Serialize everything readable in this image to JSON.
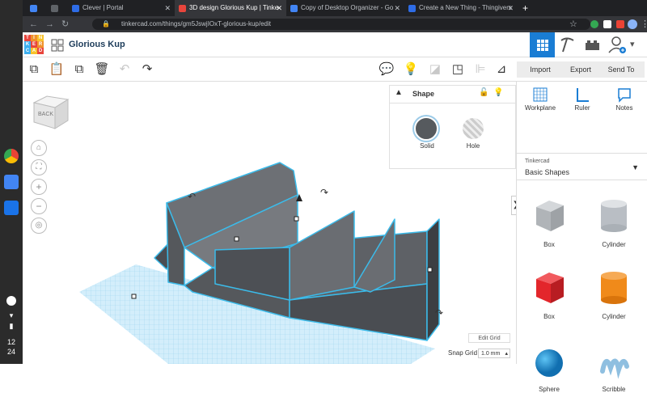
{
  "browser": {
    "tabs": [
      {
        "label": "",
        "color": "#4285f4"
      },
      {
        "label": "",
        "color": "#5f6368"
      },
      {
        "label": "Clever | Portal",
        "color": "#2e6ce6"
      },
      {
        "label": "3D design Glorious Kup | Tinke",
        "color": "#e8453c",
        "active": true
      },
      {
        "label": "Copy of Desktop Organizer - Go",
        "color": "#4285f4"
      },
      {
        "label": "Create a New Thing - Thingivers",
        "color": "#2e6ce6"
      }
    ],
    "url": "tinkercad.com/things/gm5JswjIOxT-glorious-kup/edit"
  },
  "shelf": {
    "time_hour": "12",
    "time_min": "24"
  },
  "app": {
    "logo": [
      "T",
      "I",
      "N",
      "K",
      "E",
      "R",
      "C",
      "A",
      "D"
    ],
    "design_title": "Glorious Kup",
    "actions": {
      "import": "Import",
      "export": "Export",
      "send_to": "Send To"
    }
  },
  "viewcube": {
    "label": "BACK"
  },
  "shape_panel": {
    "title": "Shape",
    "solid": "Solid",
    "hole": "Hole"
  },
  "right_panel": {
    "tools": {
      "workplane": "Workplane",
      "ruler": "Ruler",
      "notes": "Notes"
    },
    "library_label": "Tinkercad",
    "library_value": "Basic Shapes",
    "shapes": [
      {
        "label": "Box",
        "color": "#b9bec4"
      },
      {
        "label": "Cylinder",
        "color": "#b9bec4"
      },
      {
        "label": "Box",
        "color": "#e3262b"
      },
      {
        "label": "Cylinder",
        "color": "#f08a1a"
      },
      {
        "label": "Sphere",
        "color": "#1c8fd6"
      },
      {
        "label": "Scribble",
        "color": "#8fbfe0"
      }
    ]
  },
  "bottom": {
    "edit_grid": "Edit Grid",
    "snap_grid_label": "Snap Grid",
    "snap_value": "1.0 mm"
  }
}
